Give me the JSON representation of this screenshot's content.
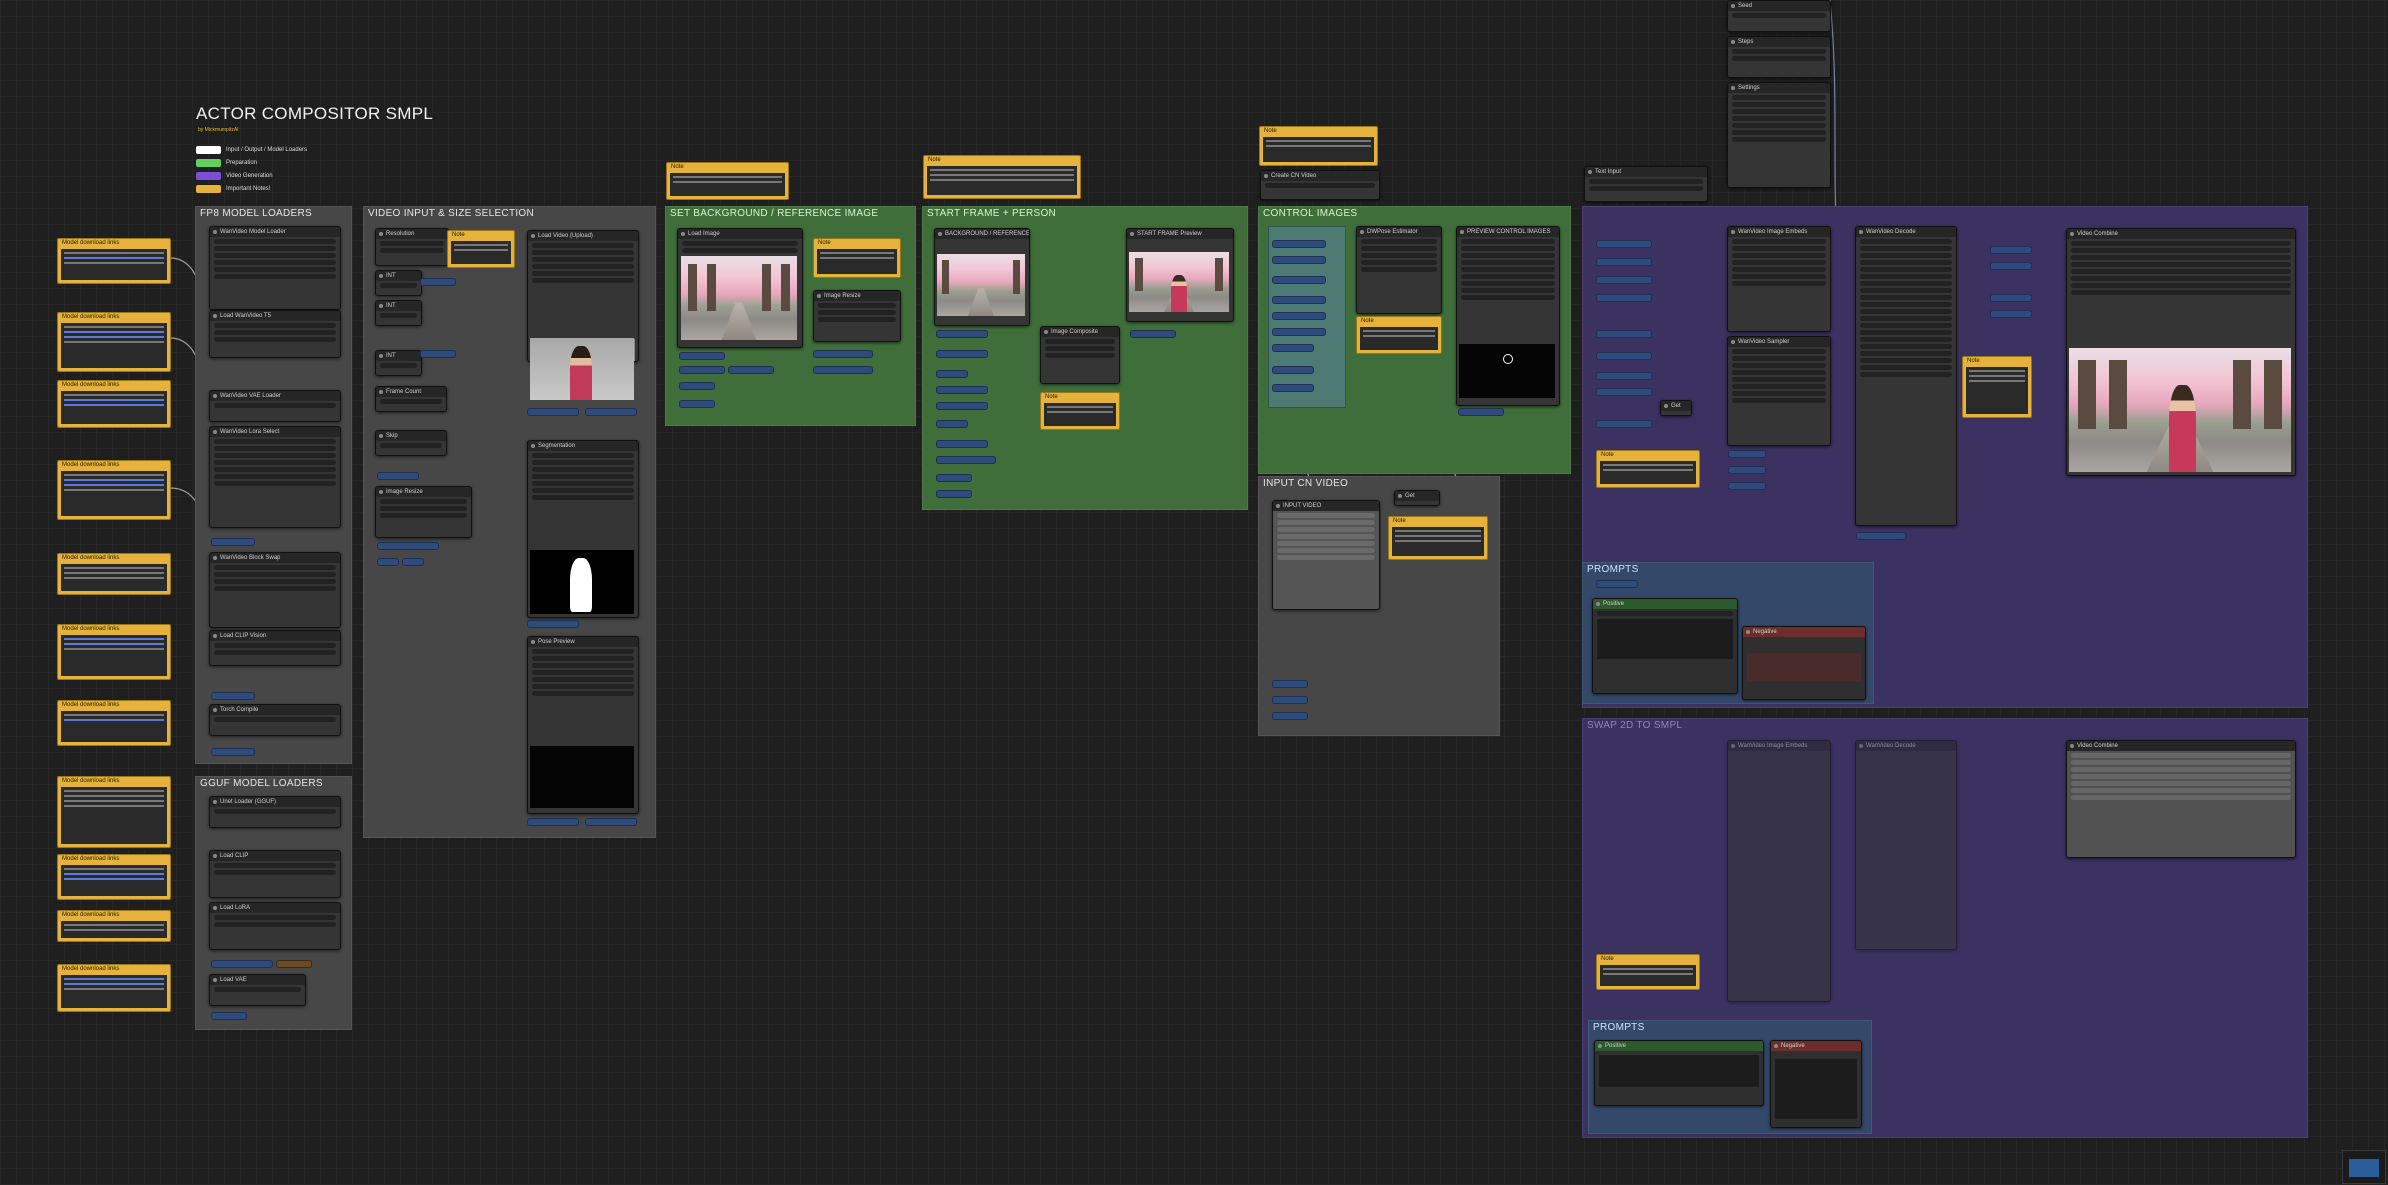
{
  "title": {
    "main": "ACTOR COMPOSITOR SMPL",
    "byline": "by MickmumpitzAI",
    "legend": [
      {
        "label": "Input / Output / Model Loaders",
        "color": "#ffffff"
      },
      {
        "label": "Preparation",
        "color": "#61d15c"
      },
      {
        "label": "Video Generation",
        "color": "#7a4fd6"
      },
      {
        "label": "Important Notes!",
        "color": "#e5b23b"
      }
    ]
  },
  "groups": {
    "fp8_loaders": "FP8 MODEL LOADERS",
    "gguf_loaders": "GGUF MODEL LOADERS",
    "video_input": "VIDEO INPUT & SIZE SELECTION",
    "set_background": "SET BACKGROUND / REFERENCE IMAGE",
    "start_frame": "START FRAME + PERSON",
    "control_images": "CONTROL IMAGES",
    "input_cn_video": "INPUT CN VIDEO",
    "prompts_top": "PROMPTS",
    "prompts_bottom": "PROMPTS",
    "bottom_right": "SWAP 2D TO SMPL"
  },
  "notes": {
    "model_download": "Model download links",
    "note": "Note"
  },
  "nodes": {
    "load_video": "Load Video (Upload)",
    "load_image": "Load Image",
    "start_frame_preview": "START FRAME Preview",
    "preview_control": "PREVIEW CONTROL IMAGES",
    "video_combine": "Video Combine",
    "background_reference": "BACKGROUND / REFERENCE",
    "wan_sampler": "WanVideo Sampler",
    "positive": "Positive",
    "negative": "Negative",
    "input_video": "INPUT VIDEO"
  },
  "colors": {
    "canvas": "#1f1f1f",
    "node": "#353535",
    "node_header": "#262626",
    "note": "#e5b23b",
    "group_grey": "#4a4a4a",
    "group_green": "#3f6e3b",
    "group_purple": "#3b3262",
    "group_blue": "#34496a",
    "reroute": "#2f4b7c"
  },
  "icons": {
    "minimap": "minimap-icon"
  }
}
